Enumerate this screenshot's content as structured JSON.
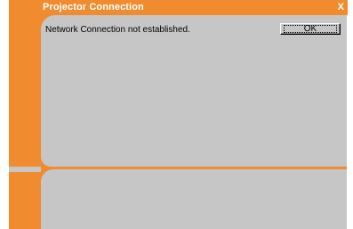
{
  "window": {
    "title": "Projector Connection",
    "close_glyph": "X"
  },
  "dialog": {
    "message": "Network Connection not established.",
    "ok_label": "OK"
  },
  "colors": {
    "accent": "#f08c2f",
    "panel": "#c6c6c6"
  }
}
